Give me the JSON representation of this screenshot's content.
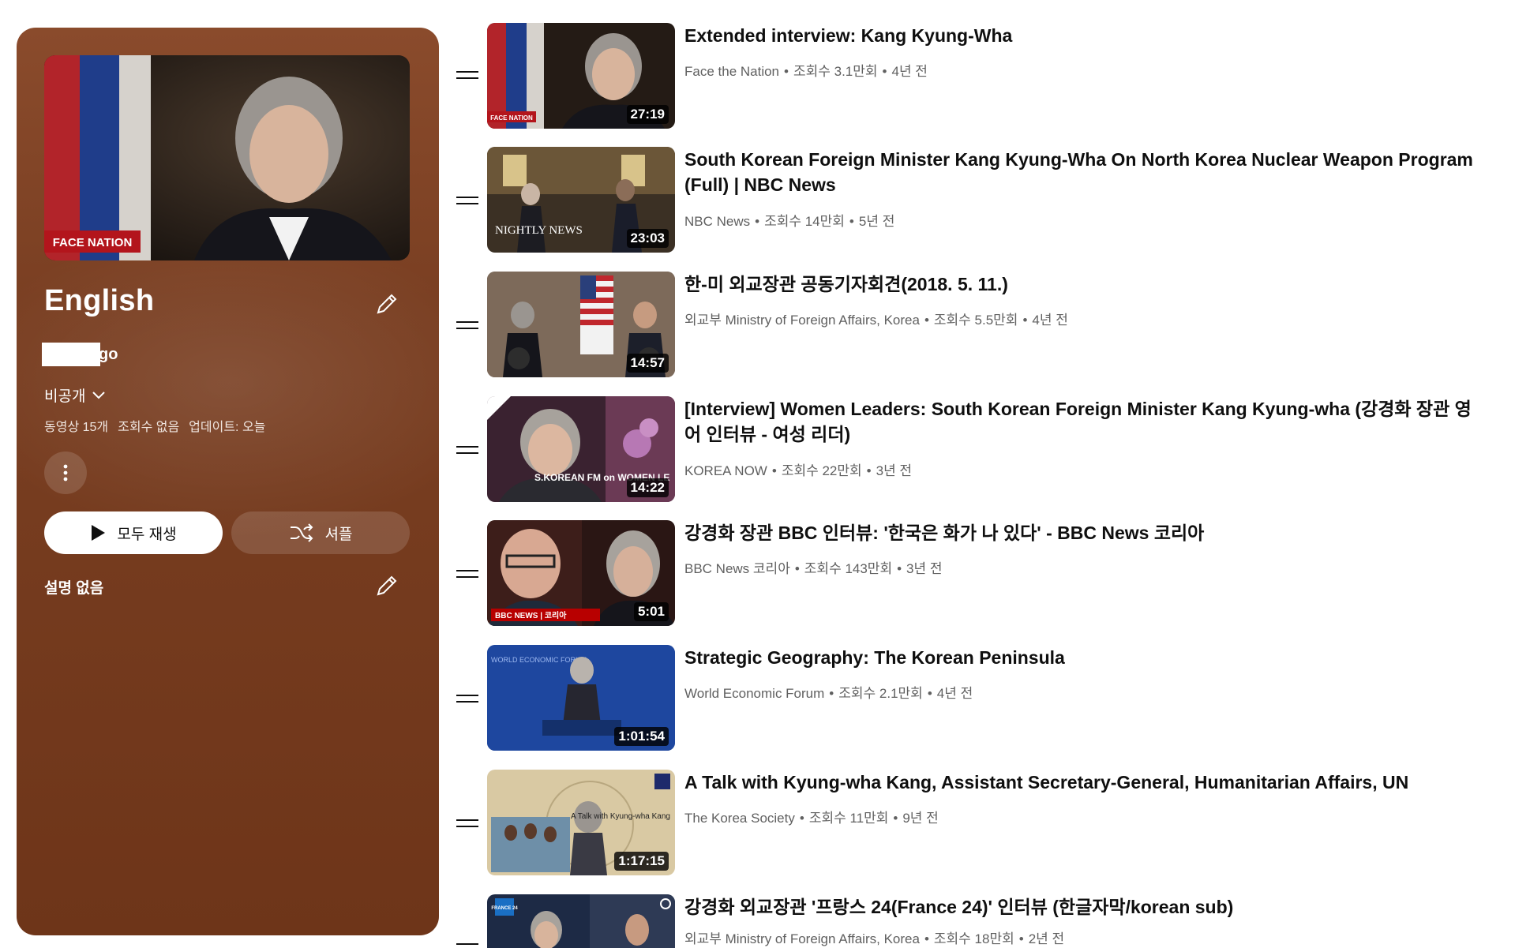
{
  "playlist": {
    "title": "English",
    "owner_suffix": "go",
    "privacy": "비공개",
    "stats": [
      "동영상 15개",
      "조회수 없음",
      "업데이트: 오늘"
    ],
    "play_all_label": "모두 재생",
    "shuffle_label": "셔플",
    "description": "설명 없음",
    "hero_badge": "FACE NATION"
  },
  "videos": [
    {
      "title": "Extended interview: Kang Kyung-Wha",
      "channel": "Face the Nation",
      "views": "조회수 3.1만회",
      "age": "4년 전",
      "duration": "27:19",
      "thumb_label": "FACE NATION"
    },
    {
      "title": "South Korean Foreign Minister Kang Kyung-Wha On North Korea Nuclear Weapon Program (Full) | NBC News",
      "channel": "NBC News",
      "views": "조회수 14만회",
      "age": "5년 전",
      "duration": "23:03",
      "thumb_label": "NIGHTLY NEWS"
    },
    {
      "title": "한-미 외교장관 공동기자회견(2018. 5. 11.)",
      "channel": "외교부 Ministry of Foreign Affairs, Korea",
      "views": "조회수 5.5만회",
      "age": "4년 전",
      "duration": "14:57",
      "thumb_label": ""
    },
    {
      "title": "[Interview] Women Leaders: South Korean Foreign Minister Kang Kyung-wha (강경화 장관 영어 인터뷰 - 여성 리더)",
      "channel": "KOREA NOW",
      "views": "조회수 22만회",
      "age": "3년 전",
      "duration": "14:22",
      "thumb_label": "S.KOREAN FM on WOMEN LE"
    },
    {
      "title": "강경화 장관 BBC 인터뷰: '한국은 화가 나 있다' - BBC News 코리아",
      "channel": "BBC News 코리아",
      "views": "조회수 143만회",
      "age": "3년 전",
      "duration": "5:01",
      "thumb_label": "BBC NEWS | 코리아"
    },
    {
      "title": "Strategic Geography: The Korean Peninsula",
      "channel": "World Economic Forum",
      "views": "조회수 2.1만회",
      "age": "4년 전",
      "duration": "1:01:54",
      "thumb_label": "WORLD ECONOMIC FORUM"
    },
    {
      "title": "A Talk with Kyung-wha Kang, Assistant Secretary-General, Humanitarian Affairs, UN",
      "channel": "The Korea Society",
      "views": "조회수 11만회",
      "age": "9년 전",
      "duration": "1:17:15",
      "thumb_label": "A Talk with Kyung-wha Kang"
    },
    {
      "title": "강경화 외교장관 '프랑스 24(France 24)' 인터뷰 (한글자막/korean sub)",
      "channel": "외교부 Ministry of Foreign Affairs, Korea",
      "views": "조회수 18만회",
      "age": "2년 전",
      "duration": "",
      "thumb_label": "FRANCE 24"
    }
  ],
  "colors": {
    "panel": "#7a3f22",
    "text_primary": "#0f0f0f",
    "text_secondary": "#606060"
  }
}
